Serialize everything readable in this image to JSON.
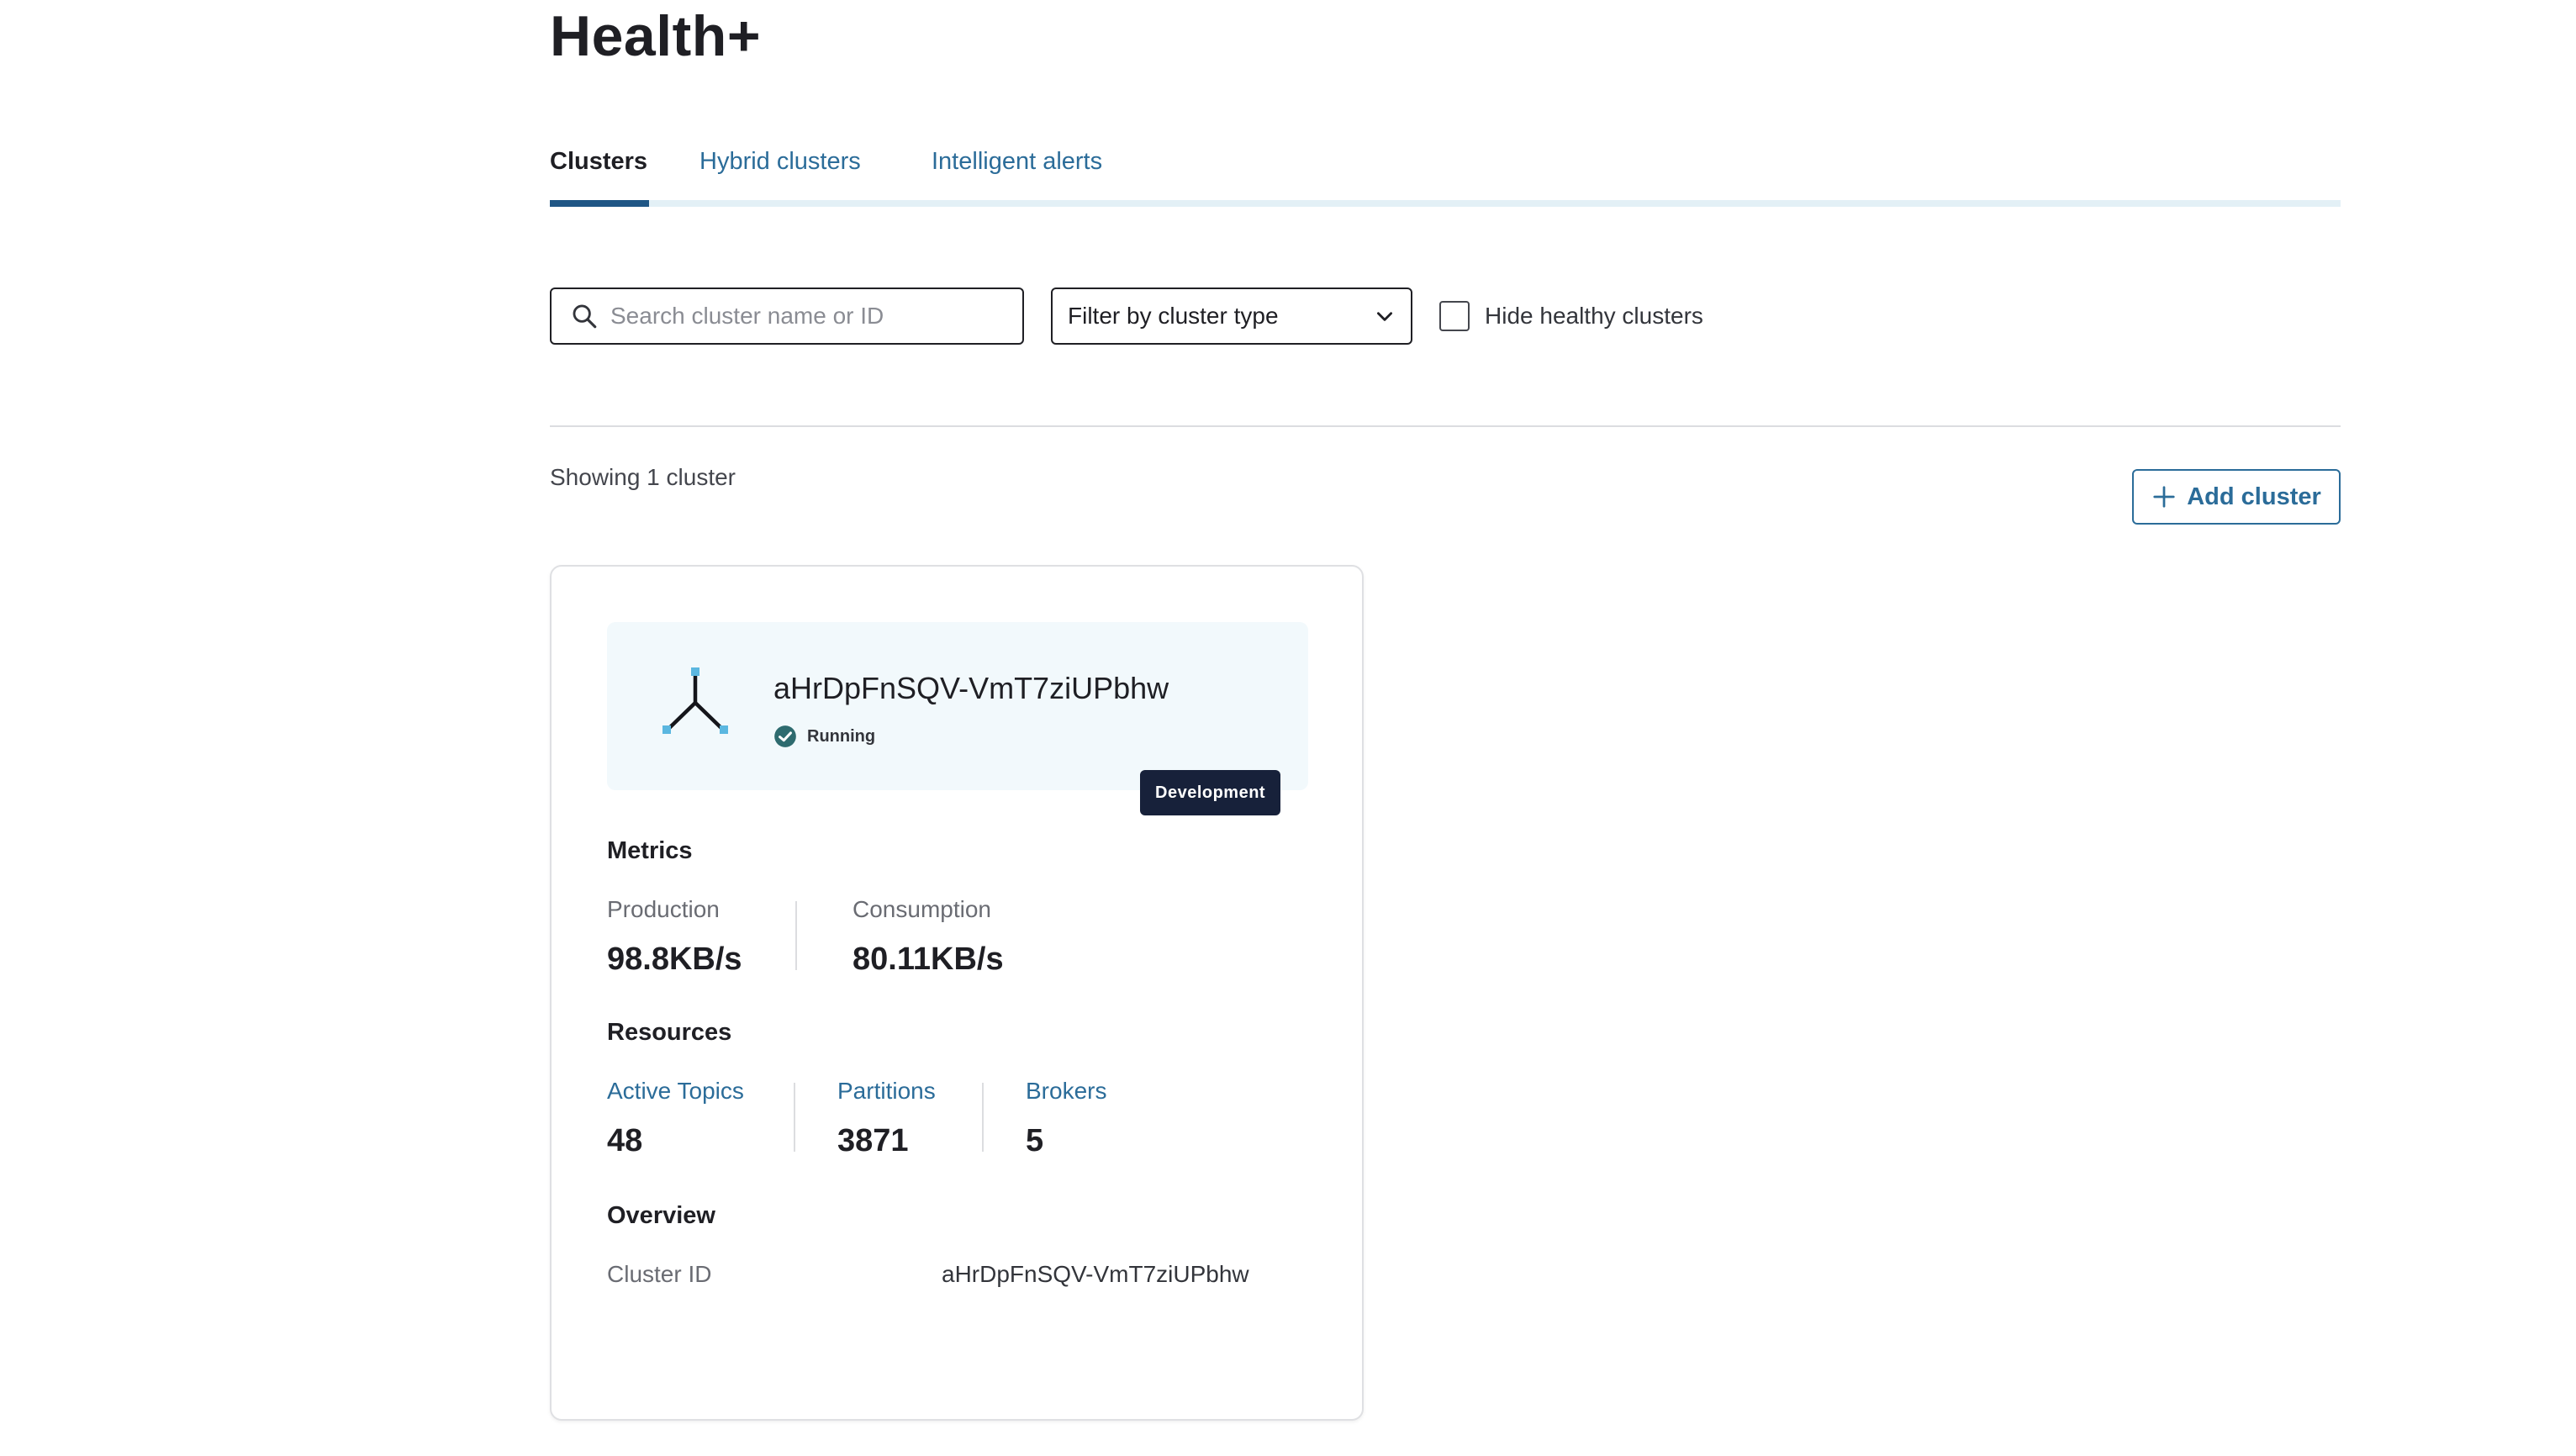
{
  "header": {
    "title": "Health+"
  },
  "tabs": [
    {
      "label": "Clusters",
      "active": true
    },
    {
      "label": "Hybrid clusters",
      "active": false
    },
    {
      "label": "Intelligent alerts",
      "active": false
    }
  ],
  "search": {
    "placeholder": "Search cluster name or ID",
    "value": "",
    "icon": "search-icon"
  },
  "filter": {
    "selected": "Filter by cluster type",
    "icon": "chevron-down-icon"
  },
  "hide_healthy": {
    "label": "Hide healthy clusters",
    "checked": false
  },
  "results": {
    "showing_text": "Showing 1 cluster"
  },
  "add_cluster": {
    "label": "Add cluster",
    "icon": "plus-icon"
  },
  "card": {
    "name": "aHrDpFnSQV-VmT7ziUPbhw",
    "status": "Running",
    "environment": "Development",
    "icon": "cluster-topology-icon",
    "metrics": {
      "title": "Metrics",
      "production_label": "Production",
      "production_value": "98.8KB/s",
      "consumption_label": "Consumption",
      "consumption_value": "80.11KB/s"
    },
    "resources": {
      "title": "Resources",
      "topics_label": "Active Topics",
      "topics_value": "48",
      "partitions_label": "Partitions",
      "partitions_value": "3871",
      "brokers_label": "Brokers",
      "brokers_value": "5"
    },
    "overview": {
      "title": "Overview",
      "cluster_id_label": "Cluster ID",
      "cluster_id_value": "aHrDpFnSQV-VmT7ziUPbhw"
    }
  },
  "colors": {
    "link": "#2b6c99",
    "tab_active_underline": "#1f5685",
    "tab_rail": "#e3f0f6",
    "card_header_bg": "#f2f9fc",
    "badge_bg": "#17213a",
    "status_running": "#2e6b6f"
  }
}
